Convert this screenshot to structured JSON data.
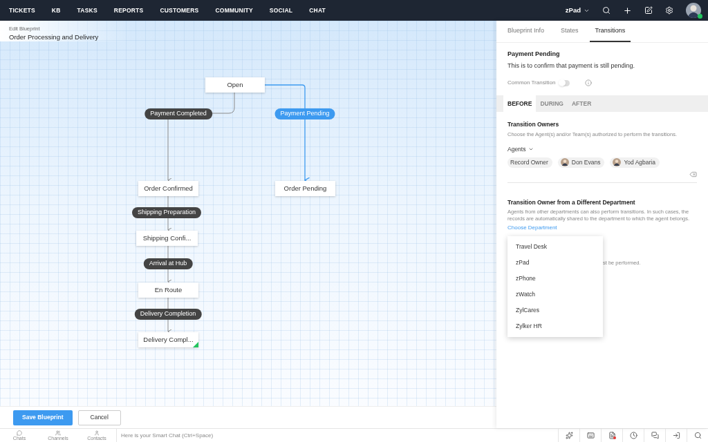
{
  "nav": {
    "items": [
      {
        "label": "TICKETS"
      },
      {
        "label": "KB"
      },
      {
        "label": "TASKS"
      },
      {
        "label": "REPORTS"
      },
      {
        "label": "CUSTOMERS"
      },
      {
        "label": "COMMUNITY"
      },
      {
        "label": "SOCIAL"
      },
      {
        "label": "CHAT"
      }
    ],
    "department": "zPad",
    "user": {
      "color": "#22c55e"
    }
  },
  "header": {
    "subtitle": "Edit Blueprint",
    "title": "Order Processing and Delivery"
  },
  "diagram": {
    "nodes": [
      {
        "kind": "state",
        "label": "Open",
        "final": false
      },
      {
        "kind": "transition",
        "label": "Payment Completed",
        "selected": false
      },
      {
        "kind": "transition",
        "label": "Payment Pending",
        "selected": true
      },
      {
        "kind": "state",
        "label": "Order Confirmed",
        "final": false
      },
      {
        "kind": "state",
        "label": "Order Pending",
        "final": false
      },
      {
        "kind": "transition",
        "label": "Shipping Preparation",
        "selected": false
      },
      {
        "kind": "state",
        "label": "Shipping Confi...",
        "final": false
      },
      {
        "kind": "transition",
        "label": "Arrival at Hub",
        "selected": false
      },
      {
        "kind": "state",
        "label": "En Route",
        "final": false
      },
      {
        "kind": "transition",
        "label": "Delivery Completion",
        "selected": false
      },
      {
        "kind": "state",
        "label": "Delivery Compl...",
        "final": true
      }
    ]
  },
  "actions": {
    "primary": "Save Blueprint",
    "secondary": "Cancel"
  },
  "panel": {
    "tabs": [
      {
        "label": "Blueprint Info",
        "selected": false
      },
      {
        "label": "States",
        "selected": false
      },
      {
        "label": "Transitions",
        "selected": true
      }
    ],
    "transition_name": "Payment Pending",
    "transition_description": "This is to confirm that payment is still pending.",
    "common_transition": {
      "label": "Common Transition",
      "on": false
    },
    "phase_tabs": [
      {
        "label": "BEFORE",
        "selected": true
      },
      {
        "label": "DURING",
        "selected": false
      },
      {
        "label": "AFTER",
        "selected": false
      }
    ],
    "owners_title": "Transition Owners",
    "owners_hint": "Choose the Agent(s) and/or Team(s) authorized to perform the transitions.",
    "agents_label": "Agents",
    "agents": [
      {
        "kind": "role",
        "name": "Record Owner"
      },
      {
        "kind": "person",
        "name": "Don Evans"
      },
      {
        "kind": "person",
        "name": "Yod Agbaria"
      }
    ],
    "dept_title": "Transition Owner from a Different Department",
    "dept_hint": "Agents from other departments can also perform transitions. In such cases, the records are automatically shared to the department to which the agent belongs.",
    "dept_link": "Choose Department",
    "hidden_text": "st be performed.",
    "dept_menu": [
      "Travel Desk",
      "zPad",
      "zPhone",
      "zWatch",
      "ZylCares",
      "Zylker HR"
    ]
  },
  "dock": {
    "items": [
      "Chats",
      "Channels",
      "Contacts"
    ],
    "chat_placeholder": "Here is your Smart Chat (Ctrl+Space)"
  }
}
